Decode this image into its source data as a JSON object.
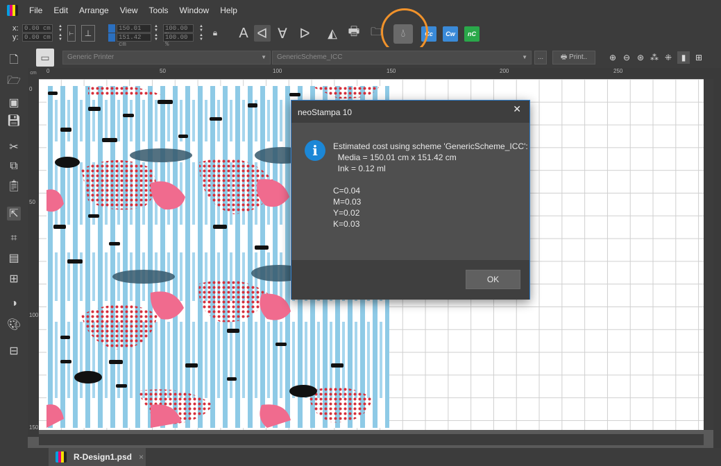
{
  "menubar": {
    "items": [
      "File",
      "Edit",
      "Arrange",
      "View",
      "Tools",
      "Window",
      "Help"
    ]
  },
  "toolbar": {
    "x_label": "x:",
    "y_label": "y:",
    "x_value": "0.00 cm",
    "y_value": "0.00 cm",
    "width_value": "150.01 cm",
    "height_value": "151.42 cm",
    "scale_x": "100.00 %",
    "scale_y": "100.00 %",
    "cost_buttons": [
      "Cc",
      "Cw",
      "nC"
    ],
    "highlight_color": "#f0922b"
  },
  "printerbar": {
    "printer": "Generic Printer",
    "scheme": "GenericScheme_ICC",
    "more": "...",
    "print": "Print.."
  },
  "ruler": {
    "unit": "cm",
    "top_labels": [
      "0",
      "50",
      "100",
      "150",
      "200",
      "250"
    ],
    "left_labels": [
      "0",
      "50",
      "100",
      "150"
    ]
  },
  "dialog": {
    "title": "neoStampa 10",
    "line1": "Estimated cost using scheme 'GenericScheme_ICC':",
    "line2": "  Media = 150.01 cm x 151.42 cm",
    "line3": "  Ink = 0.12 ml",
    "c": "C=0.04",
    "m": "M=0.03",
    "y": "Y=0.02",
    "k": "K=0.03",
    "ok": "OK",
    "accent": "#2f7fcf"
  },
  "tab": {
    "filename": "R-Design1.psd",
    "close": "×"
  }
}
